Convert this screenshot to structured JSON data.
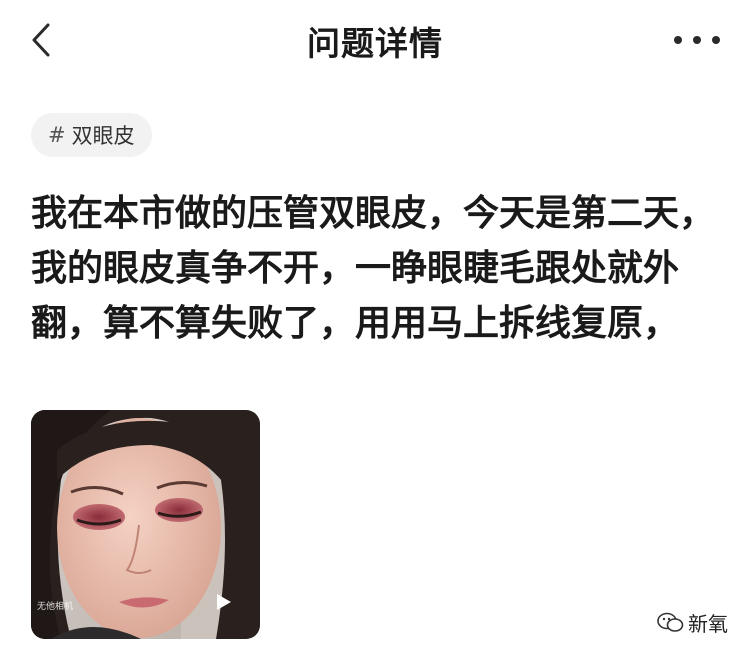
{
  "header": {
    "title": "问题详情",
    "back_icon": "chevron-left-icon",
    "more_icon": "more-horizontal-icon"
  },
  "tag": {
    "hash": "#",
    "label": "双眼皮"
  },
  "question": {
    "text": "我在本市做的压管双眼皮，今天是第二天，我的眼皮真争不开，一睁眼睫毛跟处就外翻，算不算失败了，用用马上拆线复原，"
  },
  "media": {
    "type": "video",
    "play_icon": "play-icon",
    "camera_watermark": "无他相机"
  },
  "watermark": {
    "icon": "wechat-icon",
    "text": "新氧"
  }
}
